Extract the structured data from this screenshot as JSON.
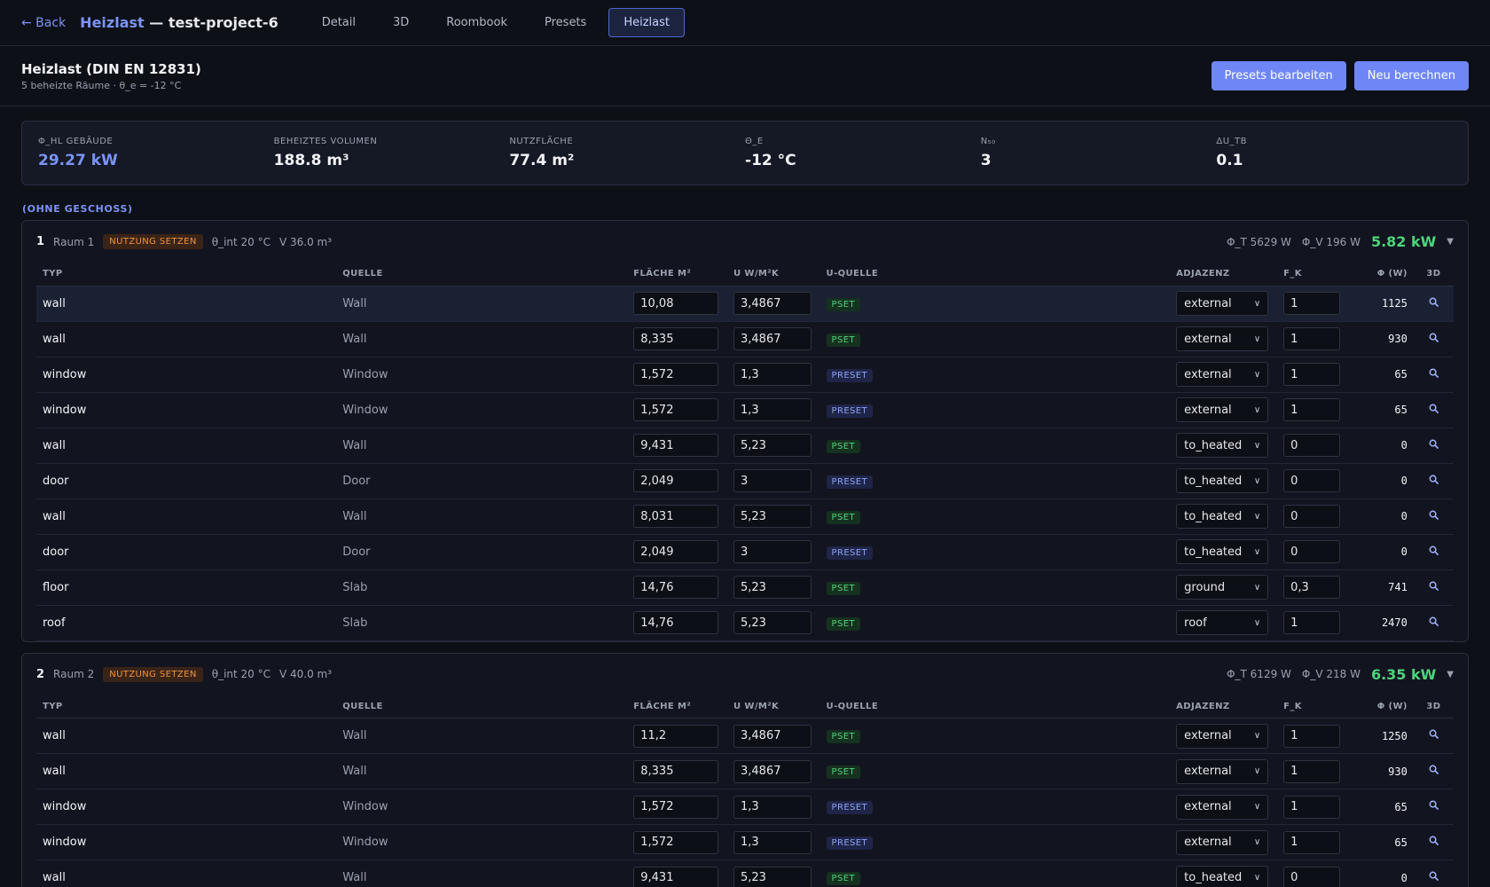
{
  "nav": {
    "back_label": "← Back",
    "title_accent": "Heizlast",
    "title_rest": " — test-project-6",
    "tabs": [
      {
        "label": "Detail",
        "active": false
      },
      {
        "label": "3D",
        "active": false
      },
      {
        "label": "Roombook",
        "active": false
      },
      {
        "label": "Presets",
        "active": false
      },
      {
        "label": "Heizlast",
        "active": true
      }
    ]
  },
  "header": {
    "title": "Heizlast (DIN EN 12831)",
    "subtitle": "5 beheizte Räume · θ_e = -12 °C",
    "btn_presets": "Presets bearbeiten",
    "btn_recalc": "Neu berechnen"
  },
  "summary": [
    {
      "label": "Φ_HL Gebäude",
      "value": "29.27 kW",
      "accent": true
    },
    {
      "label": "Beheiztes Volumen",
      "value": "188.8 m³",
      "accent": false
    },
    {
      "label": "Nutzfläche",
      "value": "77.4 m²",
      "accent": false
    },
    {
      "label": "θ_e",
      "value": "-12 °C",
      "accent": false
    },
    {
      "label": "N₅₀",
      "value": "3",
      "accent": false
    },
    {
      "label": "ΔU_TB",
      "value": "0.1",
      "accent": false
    }
  ],
  "group_label": "(OHNE GESCHOSS)",
  "columns": [
    "Typ",
    "Quelle",
    "Fläche m²",
    "U W/m²K",
    "U-Quelle",
    "Adjazenz",
    "F_k",
    "Φ (W)",
    "3D"
  ],
  "rooms": [
    {
      "num": "1",
      "name": "Raum 1",
      "badge": "NUTZUNG SETZEN",
      "theta": "θ_int 20 °C",
      "volume": "V 36.0 m³",
      "phi_t": "Φ_T 5629 W",
      "phi_v": "Φ_V 196 W",
      "total": "5.82 kW",
      "rows": [
        {
          "typ": "wall",
          "src": "Wall",
          "area": "10,08",
          "u": "3,4867",
          "uq": "PSET",
          "adj": "external",
          "fk": "1",
          "phi": "1125"
        },
        {
          "typ": "wall",
          "src": "Wall",
          "area": "8,335",
          "u": "3,4867",
          "uq": "PSET",
          "adj": "external",
          "fk": "1",
          "phi": "930"
        },
        {
          "typ": "window",
          "src": "Window",
          "area": "1,572",
          "u": "1,3",
          "uq": "PRESET",
          "adj": "external",
          "fk": "1",
          "phi": "65"
        },
        {
          "typ": "window",
          "src": "Window",
          "area": "1,572",
          "u": "1,3",
          "uq": "PRESET",
          "adj": "external",
          "fk": "1",
          "phi": "65"
        },
        {
          "typ": "wall",
          "src": "Wall",
          "area": "9,431",
          "u": "5,23",
          "uq": "PSET",
          "adj": "to_heated",
          "fk": "0",
          "phi": "0"
        },
        {
          "typ": "door",
          "src": "Door",
          "area": "2,049",
          "u": "3",
          "uq": "PRESET",
          "adj": "to_heated",
          "fk": "0",
          "phi": "0"
        },
        {
          "typ": "wall",
          "src": "Wall",
          "area": "8,031",
          "u": "5,23",
          "uq": "PSET",
          "adj": "to_heated",
          "fk": "0",
          "phi": "0"
        },
        {
          "typ": "door",
          "src": "Door",
          "area": "2,049",
          "u": "3",
          "uq": "PRESET",
          "adj": "to_heated",
          "fk": "0",
          "phi": "0"
        },
        {
          "typ": "floor",
          "src": "Slab",
          "area": "14,76",
          "u": "5,23",
          "uq": "PSET",
          "adj": "ground",
          "fk": "0,3",
          "phi": "741"
        },
        {
          "typ": "roof",
          "src": "Slab",
          "area": "14,76",
          "u": "5,23",
          "uq": "PSET",
          "adj": "roof",
          "fk": "1",
          "phi": "2470"
        }
      ]
    },
    {
      "num": "2",
      "name": "Raum 2",
      "badge": "NUTZUNG SETZEN",
      "theta": "θ_int 20 °C",
      "volume": "V 40.0 m³",
      "phi_t": "Φ_T 6129 W",
      "phi_v": "Φ_V 218 W",
      "total": "6.35 kW",
      "rows": [
        {
          "typ": "wall",
          "src": "Wall",
          "area": "11,2",
          "u": "3,4867",
          "uq": "PSET",
          "adj": "external",
          "fk": "1",
          "phi": "1250"
        },
        {
          "typ": "wall",
          "src": "Wall",
          "area": "8,335",
          "u": "3,4867",
          "uq": "PSET",
          "adj": "external",
          "fk": "1",
          "phi": "930"
        },
        {
          "typ": "window",
          "src": "Window",
          "area": "1,572",
          "u": "1,3",
          "uq": "PRESET",
          "adj": "external",
          "fk": "1",
          "phi": "65"
        },
        {
          "typ": "window",
          "src": "Window",
          "area": "1,572",
          "u": "1,3",
          "uq": "PRESET",
          "adj": "external",
          "fk": "1",
          "phi": "65"
        },
        {
          "typ": "wall",
          "src": "Wall",
          "area": "9,431",
          "u": "5,23",
          "uq": "PSET",
          "adj": "to_heated",
          "fk": "0",
          "phi": "0"
        }
      ]
    }
  ]
}
